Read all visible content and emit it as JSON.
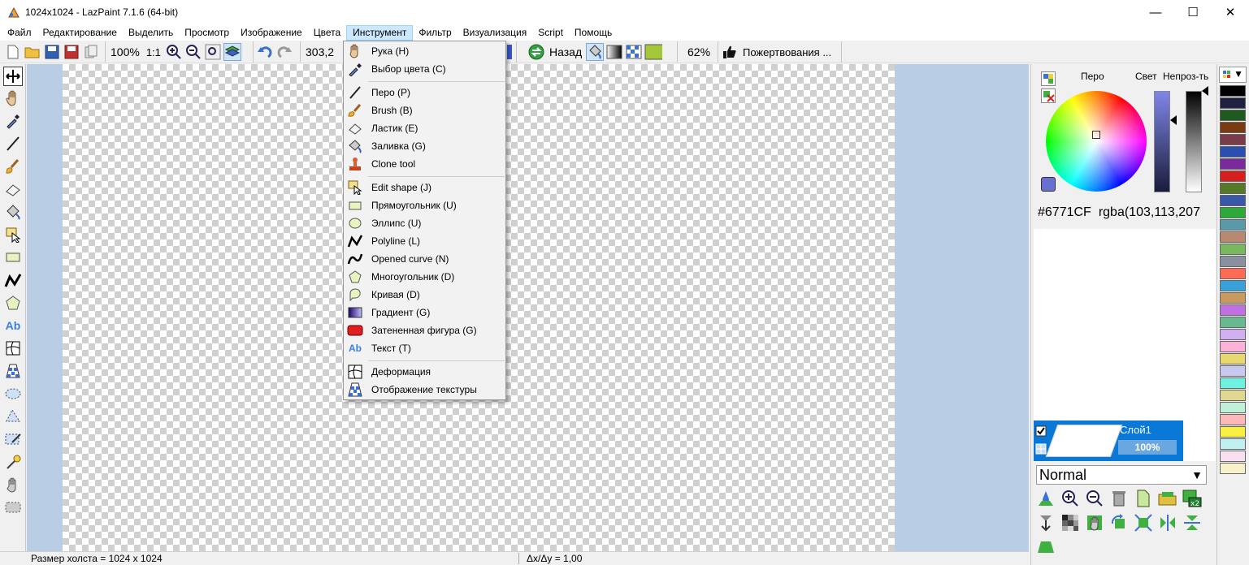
{
  "window": {
    "title": "1024x1024 - LazPaint 7.1.6 (64-bit)",
    "minimize": "—",
    "maximize": "☐",
    "close": "✕"
  },
  "menu": [
    "Файл",
    "Редактирование",
    "Выделить",
    "Просмотр",
    "Изображение",
    "Цвета",
    "Инструмент",
    "Фильтр",
    "Визуализация",
    "Script",
    "Помощь"
  ],
  "toolbar": {
    "zoom": "100%",
    "zoom_1to1": "1:1",
    "coords": "303,2",
    "back": "Назад",
    "percent": "62%",
    "donate": "Пожертвования ..."
  },
  "tools_menu": {
    "items": [
      {
        "label": "Рука (H)",
        "icon": "hand-icon"
      },
      {
        "label": "Выбор цвета (C)",
        "icon": "color-picker-icon"
      },
      {
        "label": "Перо (P)",
        "icon": "pen-icon"
      },
      {
        "label": "Brush (B)",
        "icon": "brush-icon"
      },
      {
        "label": "Ластик (E)",
        "icon": "eraser-icon"
      },
      {
        "label": "Заливка (G)",
        "icon": "fill-icon"
      },
      {
        "label": "Clone tool",
        "icon": "clone-icon"
      },
      {
        "label": "Edit shape (J)",
        "icon": "edit-shape-icon"
      },
      {
        "label": "Прямоугольник (U)",
        "icon": "rectangle-icon"
      },
      {
        "label": "Эллипс (U)",
        "icon": "ellipse-icon"
      },
      {
        "label": "Polyline (L)",
        "icon": "polyline-icon"
      },
      {
        "label": "Opened curve (N)",
        "icon": "curve-icon"
      },
      {
        "label": "Многоугольник (D)",
        "icon": "polygon-icon"
      },
      {
        "label": "Кривая (D)",
        "icon": "closed-curve-icon"
      },
      {
        "label": "Градиент (G)",
        "icon": "gradient-icon"
      },
      {
        "label": "Затененная фигура (G)",
        "icon": "shaded-shape-icon"
      },
      {
        "label": "Текст (T)",
        "icon": "text-icon"
      },
      {
        "label": "Деформация",
        "icon": "deformation-icon"
      },
      {
        "label": "Отображение текстуры",
        "icon": "texture-map-icon"
      }
    ]
  },
  "color_panel": {
    "pen_label": "Перо",
    "light_label": "Свет",
    "opacity_label": "Непроз-ть",
    "hex": "#6771CF",
    "rgba": "rgba(103,113,207",
    "current_color": "#6771CF"
  },
  "layers": {
    "name": "Слой1",
    "opacity": "100%",
    "blend_mode": "Normal"
  },
  "status": {
    "canvas_size": "Размер холста = 1024 x 1024",
    "delta": "Δx/Δy = 1,00"
  },
  "palette": [
    "#000000",
    "#202040",
    "#1f5a1f",
    "#7a3b10",
    "#7a3b4a",
    "#2a4fb0",
    "#7a2a9a",
    "#d81f1f",
    "#557a2a",
    "#3a58a8",
    "#2fa83a",
    "#5a9aa8",
    "#b88870",
    "#7ab860",
    "#8a90a0",
    "#ff6a55",
    "#3aa0d8",
    "#c89a60",
    "#c070e0",
    "#68b890",
    "#d0b0f0",
    "#ffb0d8",
    "#e8d870",
    "#c8c8f0",
    "#70f0e0",
    "#e0d890",
    "#c0f0d8",
    "#ffb8b8",
    "#f8f040",
    "#c0f0f0",
    "#f8e0f0",
    "#f8f0c8"
  ]
}
